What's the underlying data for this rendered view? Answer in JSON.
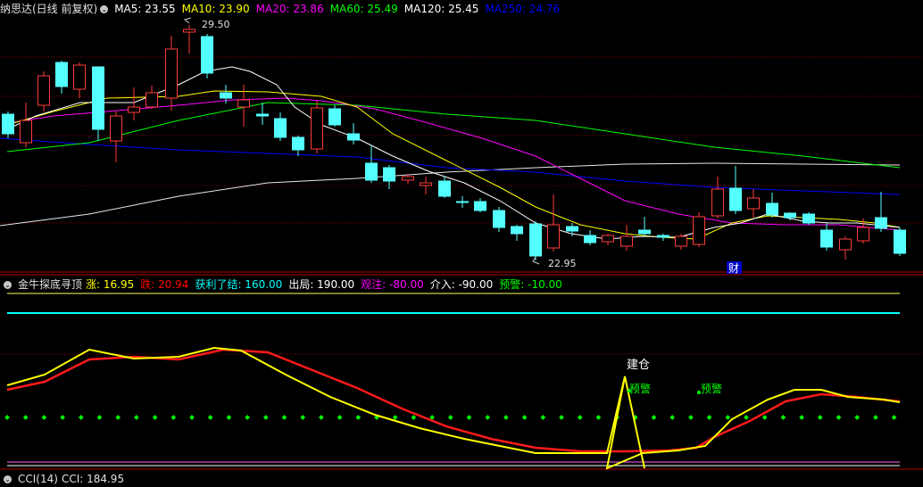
{
  "main_panel": {
    "title": "纳思达(日线 前复权)",
    "ma_labels": [
      {
        "text": "MA5: 23.55",
        "color": "#ffffff"
      },
      {
        "text": "MA10: 23.90",
        "color": "#ffff00"
      },
      {
        "text": "MA20: 23.86",
        "color": "#ff00ff"
      },
      {
        "text": "MA60: 25.49",
        "color": "#00ff00"
      },
      {
        "text": "MA120: 25.45",
        "color": "#ffffff"
      },
      {
        "text": "MA250: 24.76",
        "color": "#0000ff"
      }
    ],
    "high_label": "29.50",
    "low_label": "22.95",
    "event_badge": "财"
  },
  "indicator_panel": {
    "title": "金牛探底寻顶",
    "params": [
      {
        "text": "涨: 16.95",
        "color": "#ffff00"
      },
      {
        "text": "跌: 20.94",
        "color": "#ff0000"
      },
      {
        "text": "获利了结: 160.00",
        "color": "#00ffff"
      },
      {
        "text": "出局: 190.00",
        "color": "#ffffff"
      },
      {
        "text": "观注: -80.00",
        "color": "#ff00ff"
      },
      {
        "text": "介入: -90.00",
        "color": "#ffffff"
      },
      {
        "text": "预警: -10.00",
        "color": "#00ff00"
      }
    ],
    "signals": {
      "build": "建仓",
      "warn1": "预警",
      "warn2": "预警"
    }
  },
  "cci_panel": {
    "title": "CCI(14)",
    "value": "CCI: 184.95"
  },
  "colors": {
    "up": "#ff3c3c",
    "down": "#54ffff",
    "grid": "#8b0000",
    "bg": "#000000"
  }
}
